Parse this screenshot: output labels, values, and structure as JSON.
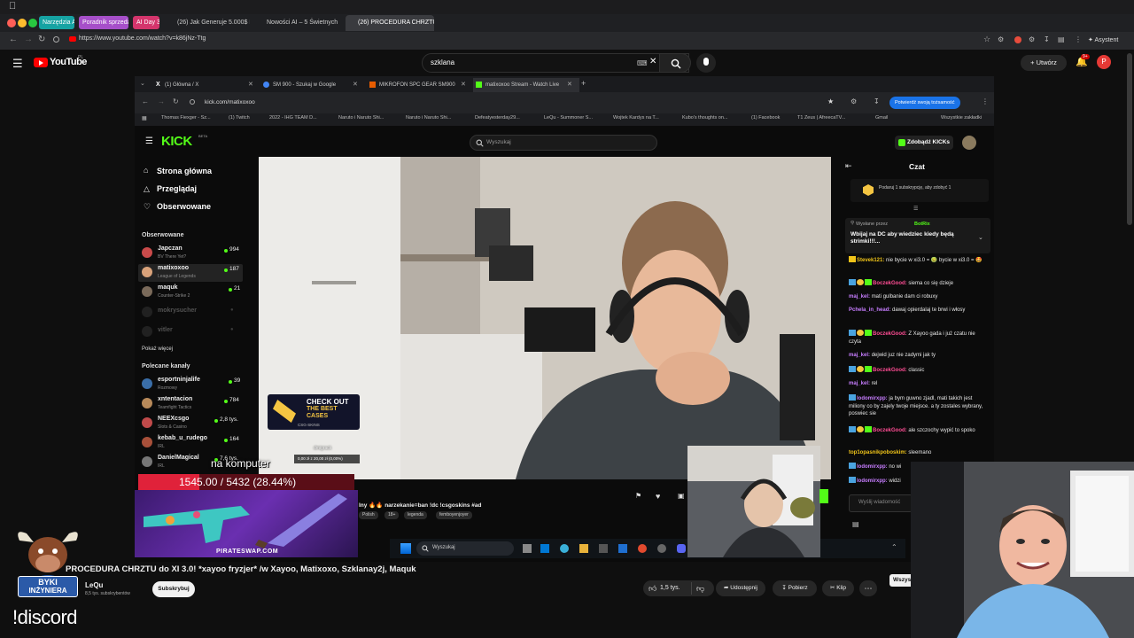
{
  "browser": {
    "url": "https://www.youtube.com/watch?v=k86jNz-Ttg",
    "pinned_tabs": [
      {
        "label": "Narzędzia AI",
        "color": "#16a3a3"
      },
      {
        "label": "Poradnik sprzedaż",
        "color": "#a64fc9"
      },
      {
        "label": "AI Day 3",
        "color": "#d4356c"
      }
    ],
    "tabs": [
      {
        "label": "(26) Jak Generuje 5.000$ D"
      },
      {
        "label": "Nowości AI – 5 Świetnych P"
      },
      {
        "label": "(26) PROCEDURA CHRZTU"
      }
    ],
    "assistant_label": "Asystent"
  },
  "youtube": {
    "logo": "YouTube",
    "logo_sup": "PL",
    "search_value": "szklana",
    "create_label": "Utwórz",
    "notif_count": "9+",
    "avatar_letter": "P",
    "video_title": "PROCEDURA CHRZTU do XI 3.0! *xayoo fryzjer* /w Xayoo, Matixoxo, Szklanay2j, Maquk",
    "channel_name": "LeQu",
    "subscribers": "8,5 tys. subskrybentów",
    "subscribe_label": "Subskrybuj",
    "likes": "1,5 tys.",
    "share_label": "Udostępnij",
    "download_label": "Pobierz",
    "clip_label": "Klip",
    "all_label": "Wszys"
  },
  "inner_browser": {
    "tabs": [
      "(1) Główna / X",
      "SM 900 - Szukaj w Google",
      "MIKROFON SPC GEAR SM900",
      "matixoxoo Stream - Watch Live"
    ],
    "url": "kick.com/matixoxoo",
    "verify_label": "Potwierdź swoją tożsamość",
    "bookmarks": [
      "Thomas Fiexger - Sz...",
      "(1) Twitch",
      "2022 - IHG TEAM D...",
      "Naruto i Naruto Shi...",
      "Naruto i Naruto Shi...",
      "Defeatyesterday29...",
      "LeQu - Summoner S...",
      "Wojtek Kardys na T...",
      "Kubo's thoughts on...",
      "(1) Facebook",
      "T1 Zeus | AfreecaTV...",
      "Gmail",
      "Wszystkie zakładki"
    ]
  },
  "kick": {
    "logo": "KICK",
    "logo_sup": "BETA",
    "search_placeholder": "Wyszukaj",
    "get_kicks": "Zdobądź KICKs",
    "nav": [
      "Strona główna",
      "Przeglądaj",
      "Obserwowane"
    ],
    "followed_title": "Obserwowane",
    "followed": [
      {
        "name": "Japczan",
        "sub": "BV There Yet?",
        "count": "994",
        "color": "#c94a4a"
      },
      {
        "name": "matixoxoo",
        "sub": "League of Legends",
        "count": "187",
        "color": "#d9a27a"
      },
      {
        "name": "maquk",
        "sub": "Counter-Strike 2",
        "count": "21",
        "color": "#7a6a5a"
      },
      {
        "name": "mokrysucher",
        "sub": "",
        "count": "",
        "color": "#555"
      },
      {
        "name": "vitler",
        "sub": "",
        "count": "",
        "color": "#555"
      }
    ],
    "show_more": "Pokaż więcej",
    "recommended_title": "Polecane kanały",
    "recommended": [
      {
        "name": "esportninjalife",
        "sub": "Rozmowy",
        "count": "39",
        "color": "#3a6ea8"
      },
      {
        "name": "xntentacion",
        "sub": "Teamfight Tactics",
        "count": "784",
        "color": "#b88a5a"
      },
      {
        "name": "NEEXcsgo",
        "sub": "Slots & Casino",
        "count": "2,8 tys.",
        "color": "#c04a4a"
      },
      {
        "name": "kebab_u_rudego",
        "sub": "IRL",
        "count": "164",
        "color": "#a8503a"
      },
      {
        "name": "DanielMagical",
        "sub": "IRL",
        "count": "7,6 tys.",
        "color": "#777"
      }
    ],
    "stream_tags_text": "lny 🔥🔥 narzekanie=ban !dc !csgoskins #ad",
    "tags": [
      "Polish",
      "18+",
      "legenda",
      "femboyenjoyer"
    ]
  },
  "chat": {
    "title": "Czat",
    "sub_prompt": "Podaruj 1 subskrypcję, aby zdobyć 1",
    "pinned_by": "Wysłane przez",
    "pinned_bot": "BotRix",
    "pinned_text": "Wbijaj na DC aby wiedziec kiedy będą strimki!!!...",
    "messages": [
      {
        "user": "Stevek121:",
        "text": "nie bycie w xi3.0 = 🤢 bycie w xi3.0 = 🤩",
        "color": "#f0c419"
      },
      {
        "user": "BoczekGood:",
        "text": "siema co się dzieje",
        "color": "#ff4d94"
      },
      {
        "user": "maj_kel:",
        "text": "mati gulbanie dam ci robuxy",
        "color": "#c77dff"
      },
      {
        "user": "Pchela_in_head:",
        "text": "dawaj opierdalaj te brwi i włosy",
        "color": "#c77dff"
      },
      {
        "user": "BoczekGood:",
        "text": "Z Xayoo gada i już czatu nie czyta",
        "color": "#ff4d94"
      },
      {
        "user": "maj_kel:",
        "text": "dejwid juz nie zadymi jak ty",
        "color": "#c77dff"
      },
      {
        "user": "BoczekGood:",
        "text": "classic",
        "color": "#ff4d94"
      },
      {
        "user": "maj_kel:",
        "text": "rel",
        "color": "#c77dff"
      },
      {
        "user": "lodomirxpp:",
        "text": "ja bym guwno zjadl, mati takich jest miliony co by zajely twoje miejsce. a ty zostales wybrany, poswiec sie",
        "color": "#c77dff"
      },
      {
        "user": "BoczekGood:",
        "text": "ale szczochy wypić to spoko",
        "color": "#ff4d94"
      },
      {
        "user": "top1opasnikpoboskim:",
        "text": "sleemano",
        "color": "#f0c419"
      },
      {
        "user": "lodomirxpp:",
        "text": "no wi",
        "color": "#c77dff"
      },
      {
        "user": "lodomirxpp:",
        "text": "widzi",
        "color": "#c77dff"
      }
    ],
    "input_placeholder": "Wyślij wiadomość"
  },
  "overlay": {
    "ad_title": "CHECK OUT",
    "ad_sub": "THE BEST CASES",
    "ad_brand": "CSG-SKINS",
    "donation_goal_label": "dmigrack",
    "donation_goal_value": "0,00 zł z 20,00 zł (0,00%)",
    "komputer_text": "na komputer",
    "goal_bar_text": "1545.00 / 5432 (28.44%)",
    "goal_percent": 28.44,
    "pirateswap": "PIRATESWAP.COM",
    "byki_line1": "BYKI",
    "byki_line2": "INŻYNIERA",
    "discord_cmd": "!discord"
  },
  "taskbar": {
    "search": "Wyszukaj"
  },
  "colors": {
    "kick_green": "#53fc18",
    "yt_red": "#ff0000",
    "goal_red": "#e0223a"
  }
}
